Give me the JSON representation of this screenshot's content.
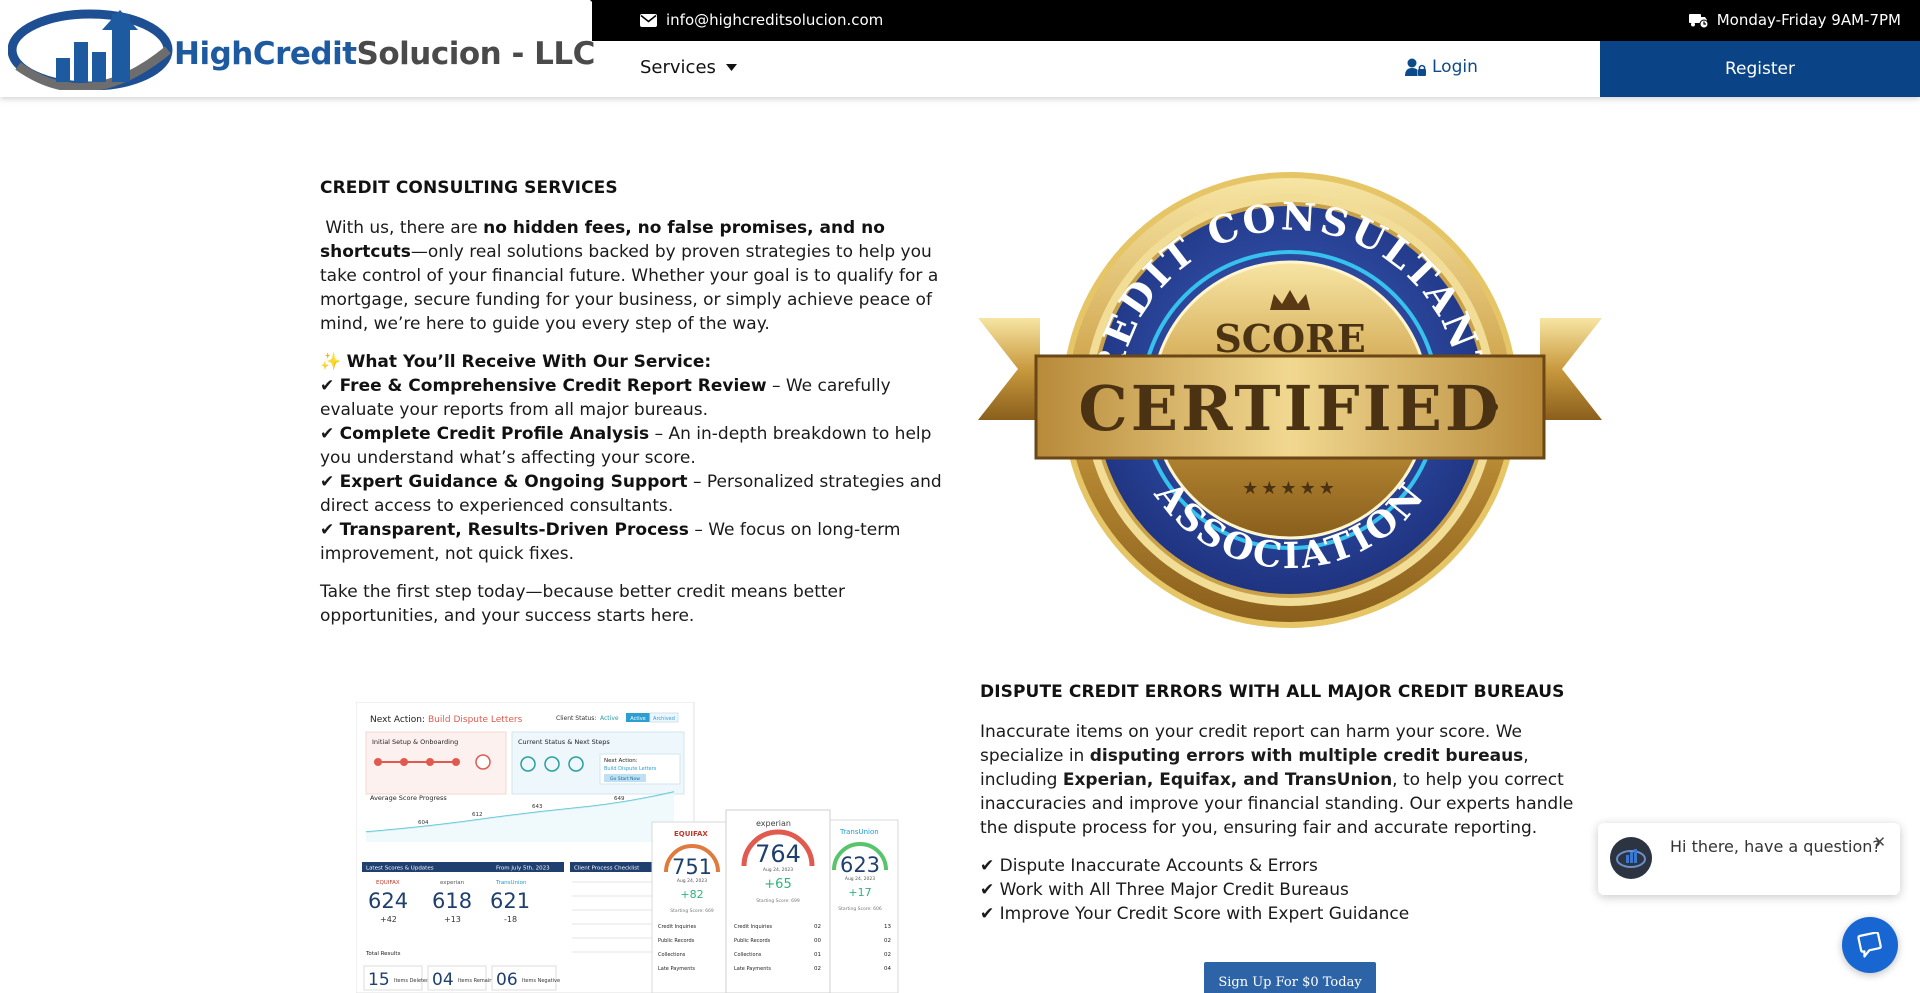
{
  "header": {
    "logo": {
      "name_part1": "HighCredit",
      "name_part2": "Solucion - LLC"
    },
    "email": "info@highcreditsolucion.com",
    "hours": "Monday-Friday 9AM-7PM",
    "nav": {
      "services_label": "Services",
      "login_label": "Login",
      "register_label": "Register"
    }
  },
  "consulting": {
    "title": "CREDIT CONSULTING SERVICES",
    "intro_pre": " With us, there are ",
    "intro_bold": "no hidden fees, no false promises, and no shortcuts",
    "intro_post": "—only real solutions backed by proven strategies to help you take control of your financial future. Whether your goal is to qualify for a mortgage, secure funding for your business, or simply achieve peace of mind, we’re here to guide you every step of the way.",
    "receive_icon": "✨",
    "receive_heading": "What You’ll Receive With Our Service:",
    "checkmark": "✔",
    "items": [
      {
        "bold": "Free & Comprehensive Credit Report Review",
        "text": " – We carefully evaluate your reports from all major bureaus."
      },
      {
        "bold": "Complete Credit Profile Analysis",
        "text": " – An in-depth breakdown to help you understand what’s affecting your score."
      },
      {
        "bold": "Expert Guidance & Ongoing Support",
        "text": " – Personalized strategies and direct access to experienced consultants."
      },
      {
        "bold": "Transparent, Results-Driven Process",
        "text": " – We focus on long-term improvement, not quick fixes."
      }
    ],
    "closing": "Take the first step today—because better credit means better opportunities, and your success starts here."
  },
  "badge": {
    "top_arc": "CREDIT CONSULTANTS",
    "score": "SCORE",
    "certified": "CERTIFIED",
    "bottom_arc": "ASSOCIATION",
    "stars": "★★★★★"
  },
  "dispute": {
    "title": "DISPUTE CREDIT ERRORS WITH ALL MAJOR CREDIT BUREAUS",
    "desc_pre": "Inaccurate items on your credit report can harm your score. We specialize in ",
    "desc_bold1": "disputing errors with multiple credit bureaus",
    "desc_mid": ", including ",
    "desc_bold2": "Experian, Equifax, and TransUnion",
    "desc_post": ", to help you correct inaccuracies and improve your financial standing. Our experts handle the dispute process for you, ensuring fair and accurate reporting.",
    "checkmark": "✔",
    "bullets": [
      "Dispute Inaccurate Accounts & Errors",
      "Work with All Three Major Credit Bureaus",
      "Improve Your Credit Score with Expert Guidance"
    ],
    "cta_label": "Sign Up For $0 Today"
  },
  "dashboard": {
    "next_action_label": "Next Action:",
    "next_action_value": "Build Dispute Letters",
    "client_status_label": "Client Status:",
    "client_status_value": "Active",
    "status_toggle_active": "Active",
    "status_toggle_archived": "Archived",
    "setup_title": "Initial Setup & Onboarding",
    "steps_title": "Current Status & Next Steps",
    "next_action_box_label": "Next Action:",
    "next_action_box_value": "Build Dispute Letters",
    "start_now": "Go Start Now",
    "avg_score_title": "Average Score Progress",
    "chart_points": [
      "604",
      "612",
      "643",
      "649"
    ],
    "latest_title": "Latest Scores & Updates",
    "from_label": "From July 5th, 2023",
    "checklist_title": "Client Process Checklist",
    "small_scores": [
      {
        "bureau": "EQUIFAX",
        "score": "624",
        "delta": "+42"
      },
      {
        "bureau": "experian",
        "score": "618",
        "delta": "+13"
      },
      {
        "bureau": "TransUnion",
        "score": "621",
        "delta": "-18"
      }
    ],
    "total_results": "Total Results",
    "results": [
      {
        "num": "15",
        "label": "Items Deleted"
      },
      {
        "num": "04",
        "label": "Items Remain"
      },
      {
        "num": "06",
        "label": "Items Negative"
      }
    ],
    "cards": [
      {
        "bureau": "EQUIFAX",
        "score": "751",
        "date": "Aug 24, 2023",
        "delta": "+82",
        "starting": "Starting Score: 669"
      },
      {
        "bureau": "experian",
        "score": "764",
        "date": "Aug 24, 2023",
        "delta": "+65",
        "starting": "Starting Score: 699"
      },
      {
        "bureau": "TransUnion",
        "score": "623",
        "date": "Aug 24, 2023",
        "delta": "+17",
        "starting": "Starting Score: 606"
      }
    ],
    "card_rows": [
      "Credit Inquiries",
      "Public Records",
      "Collections",
      "Late Payments"
    ],
    "mid_card_values": [
      "02",
      "00",
      "01",
      "02"
    ],
    "right_card_values": [
      "13",
      "02",
      "02",
      "04"
    ]
  },
  "chat": {
    "message": "Hi there, have a question?",
    "close": "✕"
  },
  "colors": {
    "brand_blue": "#0a4486",
    "top_bar": "#000000",
    "cta_blue": "#2d64a8",
    "chat_blue": "#1766d1"
  }
}
